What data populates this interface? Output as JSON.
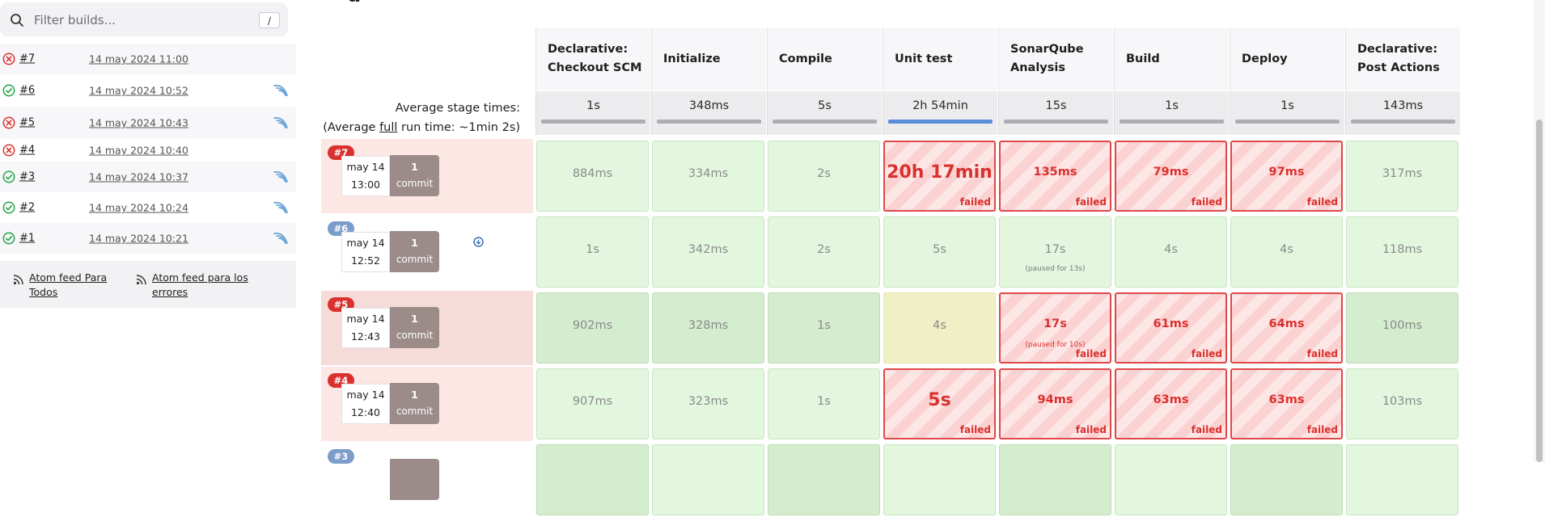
{
  "filter": {
    "placeholder": "Filter builds...",
    "shortcut": "/"
  },
  "builds": [
    {
      "number": "#7",
      "date": "14 may 2024 11:00",
      "status": "failed",
      "changes": false
    },
    {
      "number": "#6",
      "date": "14 may 2024 10:52",
      "status": "success",
      "changes": true
    },
    {
      "number": "#5",
      "date": "14 may 2024 10:43",
      "status": "failed",
      "changes": true
    },
    {
      "number": "#4",
      "date": "14 may 2024 10:40",
      "status": "failed",
      "changes": false
    },
    {
      "number": "#3",
      "date": "14 may 2024 10:37",
      "status": "success",
      "changes": true
    },
    {
      "number": "#2",
      "date": "14 may 2024 10:24",
      "status": "success",
      "changes": true
    },
    {
      "number": "#1",
      "date": "14 may 2024 10:21",
      "status": "success",
      "changes": true
    }
  ],
  "feeds": {
    "all": "Atom feed Para Todos",
    "failures": "Atom feed para los errores"
  },
  "stage_view": {
    "title_fragment": "g",
    "stages": [
      {
        "name": "Declarative: Checkout SCM",
        "avg": "1s",
        "bar": 0.02
      },
      {
        "name": "Initialize",
        "avg": "348ms",
        "bar": 0.02
      },
      {
        "name": "Compile",
        "avg": "5s",
        "bar": 0.02
      },
      {
        "name": "Unit test",
        "avg": "2h 54min",
        "bar": 1.0
      },
      {
        "name": "SonarQube Analysis",
        "avg": "15s",
        "bar": 0.02
      },
      {
        "name": "Build",
        "avg": "1s",
        "bar": 0.02
      },
      {
        "name": "Deploy",
        "avg": "1s",
        "bar": 0.02
      },
      {
        "name": "Declarative: Post Actions",
        "avg": "143ms",
        "bar": 0.02
      }
    ],
    "avg_stage_label": "Average stage times:",
    "avg_run_prefix": "(Average ",
    "avg_run_link": "full",
    "avg_run_suffix": " run time: ~1min 2s)",
    "failed_label": "failed",
    "runs": [
      {
        "badge": "#7",
        "badge_color": "red",
        "row_bg": "#fde7e5",
        "month": "may 14",
        "time": "13:00",
        "commits": "1",
        "commit_label": "commit",
        "paused_icon": false,
        "cells": [
          {
            "v": "884ms",
            "s": "ok"
          },
          {
            "v": "334ms",
            "s": "ok"
          },
          {
            "v": "2s",
            "s": "ok"
          },
          {
            "v": "20h 17min",
            "s": "fail",
            "big": true
          },
          {
            "v": "135ms",
            "s": "fail"
          },
          {
            "v": "79ms",
            "s": "fail"
          },
          {
            "v": "97ms",
            "s": "fail"
          },
          {
            "v": "317ms",
            "s": "ok"
          }
        ]
      },
      {
        "badge": "#6",
        "badge_color": "blue",
        "row_bg": "#ffffff",
        "month": "may 14",
        "time": "12:52",
        "commits": "1",
        "commit_label": "commit",
        "paused_icon": true,
        "cells": [
          {
            "v": "1s",
            "s": "ok"
          },
          {
            "v": "342ms",
            "s": "ok"
          },
          {
            "v": "2s",
            "s": "ok"
          },
          {
            "v": "5s",
            "s": "ok"
          },
          {
            "v": "17s",
            "s": "ok",
            "sub": "(paused for 13s)"
          },
          {
            "v": "4s",
            "s": "ok"
          },
          {
            "v": "4s",
            "s": "ok"
          },
          {
            "v": "118ms",
            "s": "ok"
          }
        ]
      },
      {
        "badge": "#5",
        "badge_color": "red",
        "row_bg": "#f5dcd8",
        "month": "may 14",
        "time": "12:43",
        "commits": "1",
        "commit_label": "commit",
        "paused_icon": false,
        "cells": [
          {
            "v": "902ms",
            "s": "okdk"
          },
          {
            "v": "328ms",
            "s": "okdk"
          },
          {
            "v": "1s",
            "s": "okdk"
          },
          {
            "v": "4s",
            "s": "warn"
          },
          {
            "v": "17s",
            "s": "fail",
            "sub": "(paused for 10s)"
          },
          {
            "v": "61ms",
            "s": "fail"
          },
          {
            "v": "64ms",
            "s": "fail"
          },
          {
            "v": "100ms",
            "s": "okdk"
          }
        ]
      },
      {
        "badge": "#4",
        "badge_color": "red",
        "row_bg": "#fde7e5",
        "month": "may 14",
        "time": "12:40",
        "commits": "1",
        "commit_label": "commit",
        "paused_icon": false,
        "cells": [
          {
            "v": "907ms",
            "s": "ok"
          },
          {
            "v": "323ms",
            "s": "ok"
          },
          {
            "v": "1s",
            "s": "ok"
          },
          {
            "v": "5s",
            "s": "fail",
            "big": true
          },
          {
            "v": "94ms",
            "s": "fail"
          },
          {
            "v": "63ms",
            "s": "fail"
          },
          {
            "v": "63ms",
            "s": "fail"
          },
          {
            "v": "103ms",
            "s": "ok"
          }
        ]
      },
      {
        "badge": "#3",
        "badge_color": "blue",
        "row_bg": "#ffffff",
        "month": "",
        "time": "",
        "commits": "",
        "commit_label": "",
        "paused_icon": false,
        "cells": [
          {
            "v": "",
            "s": "okdk"
          },
          {
            "v": "",
            "s": "ok"
          },
          {
            "v": "",
            "s": "okdk"
          },
          {
            "v": "",
            "s": "ok"
          },
          {
            "v": "",
            "s": "okdk"
          },
          {
            "v": "",
            "s": "ok"
          },
          {
            "v": "",
            "s": "okdk"
          },
          {
            "v": "",
            "s": "ok"
          }
        ]
      }
    ]
  },
  "colors": {
    "failed": "#d9312e",
    "success": "#1ea446",
    "ok_cell": "#e2f7de",
    "fail_cell": "#fbd2d2",
    "accent": "#5b8ed8"
  }
}
